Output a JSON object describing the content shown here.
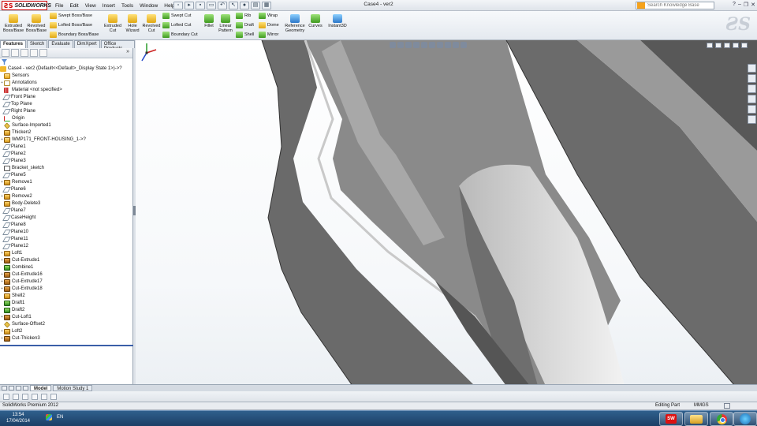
{
  "app": {
    "logo_text": "SOLIDWORKS",
    "document_title": "Case4 - ver2"
  },
  "menu": [
    "File",
    "Edit",
    "View",
    "Insert",
    "Tools",
    "Window",
    "Help"
  ],
  "search": {
    "placeholder": "Search Knowledge Base"
  },
  "ribbon": {
    "extruded_boss": "Extruded Boss/Base",
    "revolved_boss": "Revolved Boss/Base",
    "swept_boss": "Swept Boss/Base",
    "lofted_boss": "Lofted Boss/Base",
    "boundary_boss": "Boundary Boss/Base",
    "extruded_cut": "Extruded Cut",
    "hole_wizard": "Hole Wizard",
    "revolved_cut": "Revolved Cut",
    "swept_cut": "Swept Cut",
    "lofted_cut": "Lofted Cut",
    "boundary_cut": "Boundary Cut",
    "fillet": "Fillet",
    "linear_pattern": "Linear Pattern",
    "rib": "Rib",
    "draft": "Draft",
    "shell": "Shell",
    "wrap": "Wrap",
    "dome": "Dome",
    "mirror": "Mirror",
    "reference_geometry": "Reference Geometry",
    "curves": "Curves",
    "instant3d": "Instant3D"
  },
  "cm_tabs": [
    "Features",
    "Sketch",
    "Evaluate",
    "DimXpert",
    "Office Products"
  ],
  "tree": {
    "root": "Case4 - ver2  (Default<<Default>_Display State 1>)->?",
    "items": [
      {
        "label": "Sensors",
        "icon": "folder-icon",
        "exp": ""
      },
      {
        "label": "Annotations",
        "icon": "annotation-icon",
        "exp": "+"
      },
      {
        "label": "Material <not specified>",
        "icon": "material-icon",
        "exp": ""
      },
      {
        "label": "Front Plane",
        "icon": "plane-icon",
        "exp": ""
      },
      {
        "label": "Top Plane",
        "icon": "plane-icon",
        "exp": ""
      },
      {
        "label": "Right Plane",
        "icon": "plane-icon",
        "exp": ""
      },
      {
        "label": "Origin",
        "icon": "origin-icon",
        "exp": ""
      },
      {
        "label": "Surface-Imported1",
        "icon": "surface-icon",
        "exp": ""
      },
      {
        "label": "Thicken2",
        "icon": "feature-icon",
        "exp": ""
      },
      {
        "label": "WMP171_FRONT-HOUSING_1->?",
        "icon": "part-icon",
        "exp": "+"
      },
      {
        "label": "Plane1",
        "icon": "plane-icon",
        "exp": ""
      },
      {
        "label": "Plane2",
        "icon": "plane-icon",
        "exp": ""
      },
      {
        "label": "Plane3",
        "icon": "plane-icon",
        "exp": ""
      },
      {
        "label": "Bracket_sketch",
        "icon": "sketch-icon",
        "exp": ""
      },
      {
        "label": "Plane5",
        "icon": "plane-icon",
        "exp": ""
      },
      {
        "label": "Remove1",
        "icon": "feature-icon",
        "exp": "+"
      },
      {
        "label": "Plane6",
        "icon": "plane-icon",
        "exp": ""
      },
      {
        "label": "Remove2",
        "icon": "feature-icon",
        "exp": "+"
      },
      {
        "label": "Body-Delete3",
        "icon": "feature-icon",
        "exp": ""
      },
      {
        "label": "Plane7",
        "icon": "plane-icon",
        "exp": ""
      },
      {
        "label": "CaseHeight",
        "icon": "plane-icon",
        "exp": ""
      },
      {
        "label": "Plane8",
        "icon": "plane-icon",
        "exp": ""
      },
      {
        "label": "Plane10",
        "icon": "plane-icon",
        "exp": ""
      },
      {
        "label": "Plane11",
        "icon": "plane-icon",
        "exp": ""
      },
      {
        "label": "Plane12",
        "icon": "plane-icon",
        "exp": ""
      },
      {
        "label": "Loft1",
        "icon": "feature-icon",
        "exp": "+"
      },
      {
        "label": "Cut-Extrude1",
        "icon": "cut-icon",
        "exp": "+"
      },
      {
        "label": "Combine1",
        "icon": "green-feature-icon",
        "exp": ""
      },
      {
        "label": "Cut-Extrude16",
        "icon": "cut-icon",
        "exp": "+"
      },
      {
        "label": "Cut-Extrude17",
        "icon": "cut-icon",
        "exp": "+"
      },
      {
        "label": "Cut-Extrude18",
        "icon": "cut-icon",
        "exp": "+"
      },
      {
        "label": "Shell2",
        "icon": "feature-icon",
        "exp": ""
      },
      {
        "label": "Draft1",
        "icon": "green-feature-icon",
        "exp": ""
      },
      {
        "label": "Draft2",
        "icon": "green-feature-icon",
        "exp": ""
      },
      {
        "label": "Cut-Loft1",
        "icon": "cut-icon",
        "exp": "+"
      },
      {
        "label": "Surface-Offset2",
        "icon": "surface-icon",
        "exp": ""
      },
      {
        "label": "Loft2",
        "icon": "feature-icon",
        "exp": "+"
      },
      {
        "label": "Cut-Thicken3",
        "icon": "cut-icon",
        "exp": "+"
      }
    ]
  },
  "bottom_tabs": [
    "Model",
    "Motion Study 1"
  ],
  "status": {
    "product": "SolidWorks Premium 2012",
    "mode": "Editing Part",
    "units": "MMGS"
  },
  "taskbar": {
    "time": "13:54",
    "date": "17/04/2014",
    "lang": "EN"
  }
}
